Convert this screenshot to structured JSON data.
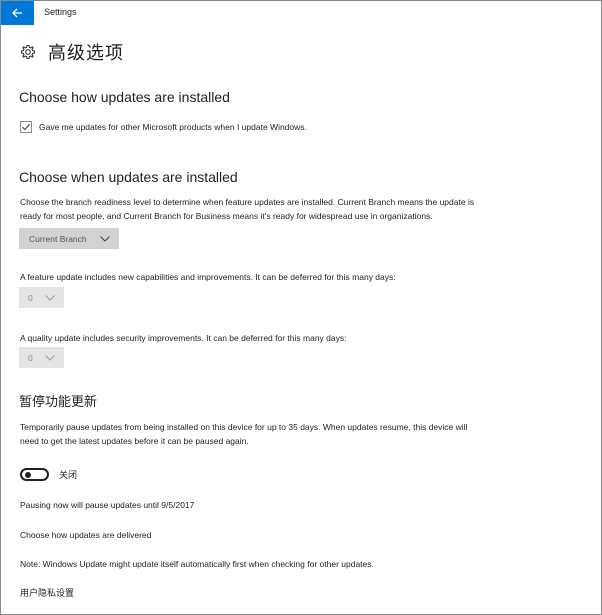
{
  "window": {
    "title": "Settings"
  },
  "header": {
    "icon": "gear-icon",
    "title": "高级选项"
  },
  "install_section": {
    "title": "Choose how updates are installed",
    "checkbox_label": "Gave me updates for other Microsoft products when I update Windows.",
    "checkbox_checked": true
  },
  "when_section": {
    "title": "Choose when updates are installed",
    "description_line1": "Choose the branch readiness level to determine when feature updates are installed. Current Branch means the update is",
    "description_line2": "ready for most people, and Current Branch for Business means it's ready for widespread use in organizations.",
    "branch_dropdown_value": "Current Branch",
    "feature_text": "A feature update includes new capabilities and improvements. It can be deferred for this many days:",
    "feature_dropdown_value": "0",
    "quality_text": "A quality update includes security improvements. It can be deferred for this many days:",
    "quality_dropdown_value": "0"
  },
  "pause_section": {
    "title": "暂停功能更新",
    "description_line1": "Temporarily pause updates from being installed on this device for up to 35 days. When updates resume, this device will",
    "description_line2": "need to get the latest updates before it can be paused again.",
    "toggle_label": "关闭",
    "toggle_on": false,
    "pause_info": "Pausing now will pause updates until 9/5/2017"
  },
  "links": {
    "delivery": "Choose how updates are delivered",
    "note": "Note: Windows Update might update itself automatically first when checking for other updates.",
    "privacy": "用户隐私设置"
  },
  "colors": {
    "accent": "#0078d7",
    "dropdown_bg": "#d2d2d2",
    "dropdown_disabled_bg": "#e4e4e4"
  }
}
